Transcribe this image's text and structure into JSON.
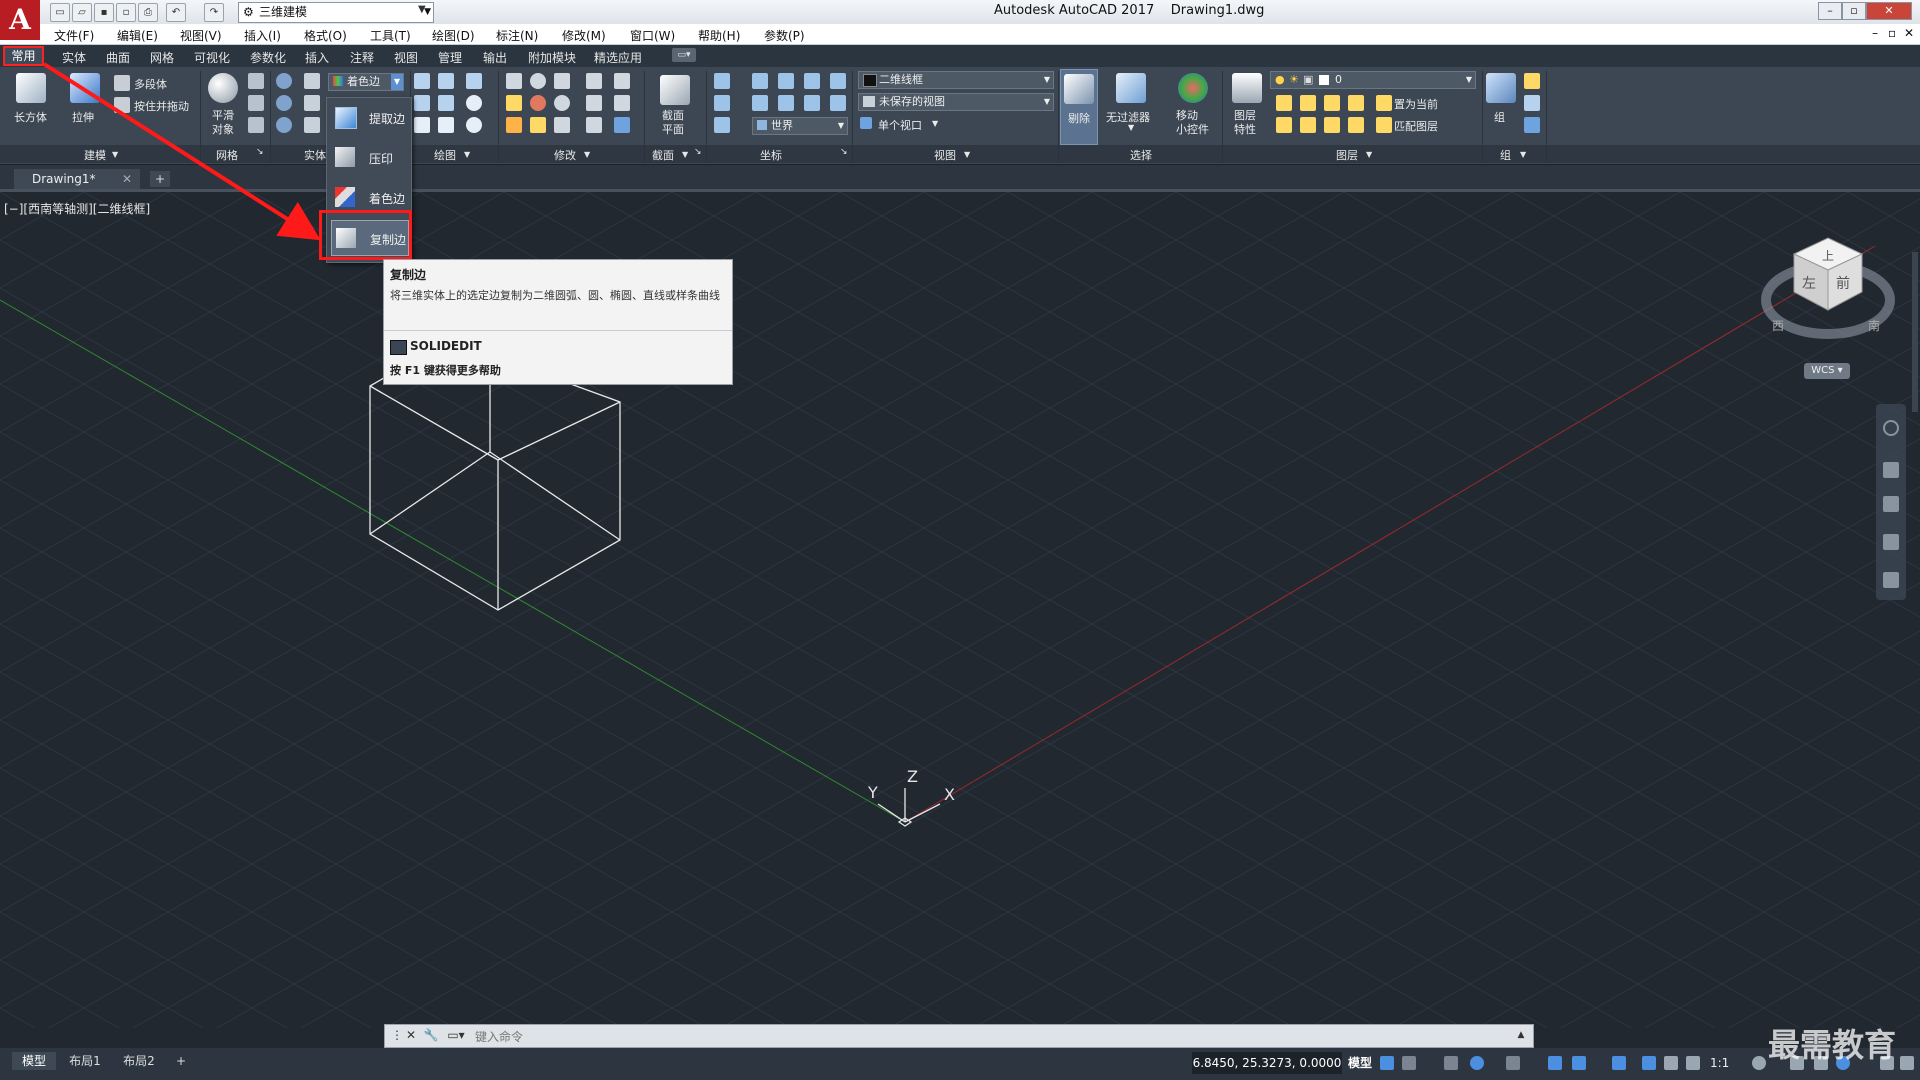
{
  "app": {
    "title": "Autodesk AutoCAD 2017",
    "filename": "Drawing1.dwg",
    "logo": "A",
    "workspace": "三维建模"
  },
  "menus": [
    "文件(F)",
    "编辑(E)",
    "视图(V)",
    "插入(I)",
    "格式(O)",
    "工具(T)",
    "绘图(D)",
    "标注(N)",
    "修改(M)",
    "窗口(W)",
    "帮助(H)",
    "参数(P)"
  ],
  "ribbon_tabs": [
    "常用",
    "实体",
    "曲面",
    "网格",
    "可视化",
    "参数化",
    "插入",
    "注释",
    "视图",
    "管理",
    "输出",
    "附加模块",
    "精选应用"
  ],
  "ribbon": {
    "box_label": "长方体",
    "extrude_label": "拉伸",
    "polysolid_label": "多段体",
    "presspull_label": "按住并拖动",
    "smooth_label": "平滑\n对象",
    "color_edges_combo": "着色边",
    "section_plane_label": "截面\n平面",
    "ucs_world": "世界",
    "visual_style": "二维线框",
    "view_combo": "未保存的视图",
    "single_viewport": "单个视口",
    "cull_label": "剔除",
    "no_filter_label": "无过滤器",
    "move_gizmo_label": "移动\n小控件",
    "layer_props_label": "图层\n特性",
    "layer_combo": "0",
    "set_current": "置为当前",
    "match_layer": "匹配图层",
    "group_label": "组",
    "panels": {
      "modeling": "建模",
      "mesh": "网格",
      "solid_edit": "实体",
      "draw": "绘图",
      "modify": "修改",
      "section": "截面",
      "coordinates": "坐标",
      "view": "视图",
      "selection": "选择",
      "layers": "图层",
      "groups": "组"
    }
  },
  "file_tab": "Drawing1*",
  "viewport_label": "[−][西南等轴测][二维线框]",
  "dropdown": {
    "items": [
      "提取边",
      "压印",
      "着色边",
      "复制边"
    ],
    "selected": "复制边"
  },
  "tooltip": {
    "title": "复制边",
    "description": "将三维实体上的选定边复制为二维圆弧、圆、椭圆、直线或样条曲线",
    "command": "SOLIDEDIT",
    "help": "按 F1 键获得更多帮助"
  },
  "viewcube": {
    "faces": [
      "上",
      "左",
      "前"
    ],
    "compass": [
      "西",
      "南"
    ],
    "wcs": "WCS"
  },
  "axes": {
    "x": "X",
    "y": "Y",
    "z": "Z"
  },
  "command_line": {
    "placeholder": "键入命令"
  },
  "layout_tabs": [
    "模型",
    "布局1",
    "布局2"
  ],
  "status": {
    "coords": "6.8450, 25.3273, 0.0000",
    "model": "模型",
    "scale": "1:1"
  },
  "watermark": "最需教育"
}
